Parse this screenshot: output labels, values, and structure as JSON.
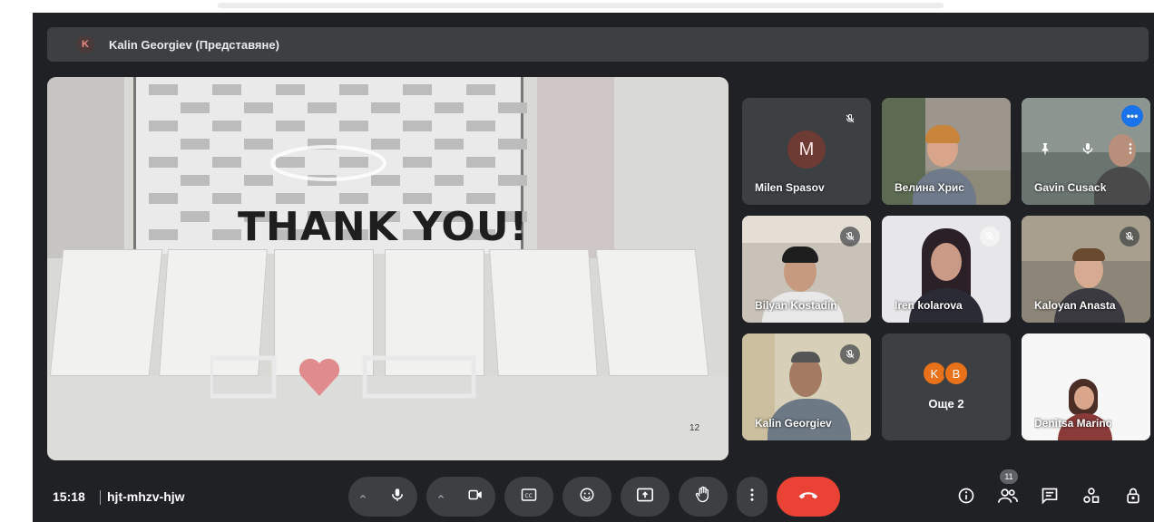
{
  "presenting": {
    "avatar_letter": "K",
    "label": "Kalin Georgiev (Представяне)"
  },
  "slide": {
    "heading": "THANK YOU!",
    "page_number": "12"
  },
  "participants": [
    {
      "name": "Milen Spasov",
      "avatar_letter": "M",
      "muted": true
    },
    {
      "name": "Велина Хрис",
      "muted": false
    },
    {
      "name": "Gavin Cusack",
      "muted": false,
      "active": true
    },
    {
      "name": "Bilyan Kostadin",
      "muted": true
    },
    {
      "name": "Iren kolarova",
      "muted": false
    },
    {
      "name": "Kaloyan Anasta",
      "muted": true
    },
    {
      "name": "Kalin Georgiev",
      "muted": true
    },
    {
      "name": "Denitsa Marino",
      "muted": false
    }
  ],
  "others": {
    "label": "Още 2",
    "avatars": [
      {
        "letter": "K",
        "color": "#e8711a"
      },
      {
        "letter": "B",
        "color": "#e8711a"
      }
    ]
  },
  "meeting": {
    "time": "15:18",
    "code": "hjt-mhzv-hjw"
  },
  "people_count": "11",
  "colors": {
    "background": "#202124",
    "tile": "#3c4043",
    "hangup": "#ea4335",
    "accent": "#1a73e8"
  },
  "icons": {
    "mic": "mic-icon",
    "camera": "camera-icon",
    "captions": "captions-icon",
    "emoji": "emoji-icon",
    "present": "present-icon",
    "hand": "raise-hand-icon",
    "more": "more-vert-icon",
    "hangup": "hangup-icon",
    "info": "info-icon",
    "people": "people-icon",
    "chat": "chat-icon",
    "activities": "activities-icon",
    "host": "host-controls-icon"
  }
}
